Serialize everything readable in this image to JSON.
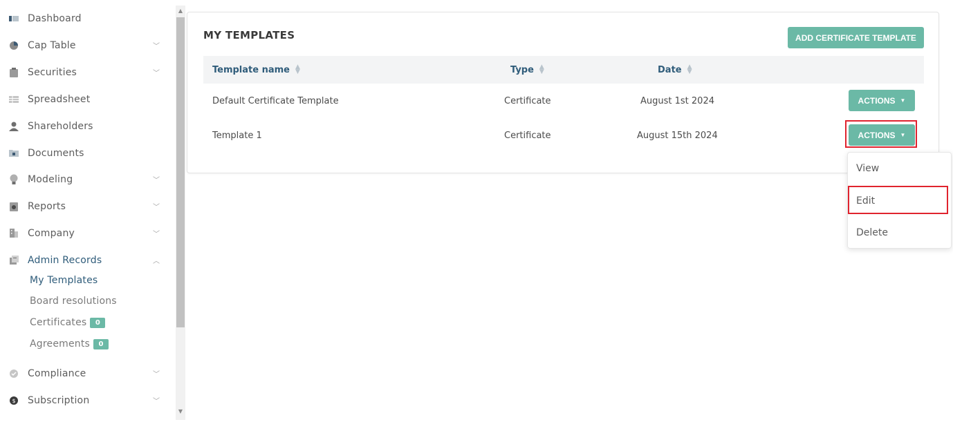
{
  "sidebar": {
    "items": [
      {
        "label": "Dashboard",
        "icon": "dashboard-icon"
      },
      {
        "label": "Cap Table",
        "icon": "pie-chart-icon",
        "chevron": "v"
      },
      {
        "label": "Securities",
        "icon": "clipboard-icon",
        "chevron": "v"
      },
      {
        "label": "Spreadsheet",
        "icon": "spreadsheet-icon"
      },
      {
        "label": "Shareholders",
        "icon": "user-icon"
      },
      {
        "label": "Documents",
        "icon": "folder-icon"
      },
      {
        "label": "Modeling",
        "icon": "lightbulb-icon",
        "chevron": "v"
      },
      {
        "label": "Reports",
        "icon": "report-icon",
        "chevron": "v"
      },
      {
        "label": "Company",
        "icon": "building-icon",
        "chevron": "v"
      },
      {
        "label": "Admin Records",
        "icon": "admin-records-icon",
        "chevron": "^"
      },
      {
        "label": "Compliance",
        "icon": "shield-check-icon",
        "chevron": "v"
      },
      {
        "label": "Subscription",
        "icon": "dollar-coin-icon",
        "chevron": "v"
      }
    ],
    "sub_items": [
      {
        "label": "My Templates"
      },
      {
        "label": "Board resolutions"
      },
      {
        "label": "Certificates",
        "badge": "0"
      },
      {
        "label": "Agreements",
        "badge": "0"
      }
    ]
  },
  "main": {
    "title": "MY TEMPLATES",
    "add_button": "ADD CERTIFICATE TEMPLATE",
    "columns": [
      "Template name",
      "Type",
      "Date"
    ],
    "rows": [
      {
        "name": "Default Certificate Template",
        "type": "Certificate",
        "date": "August 1st 2024",
        "action": "ACTIONS"
      },
      {
        "name": "Template 1",
        "type": "Certificate",
        "date": "August 15th 2024",
        "action": "ACTIONS"
      }
    ],
    "dropdown": [
      "View",
      "Edit",
      "Delete"
    ]
  },
  "colors": {
    "accent": "#6bb9a6",
    "link": "#2f5c7a",
    "highlight": "#e0232e"
  }
}
